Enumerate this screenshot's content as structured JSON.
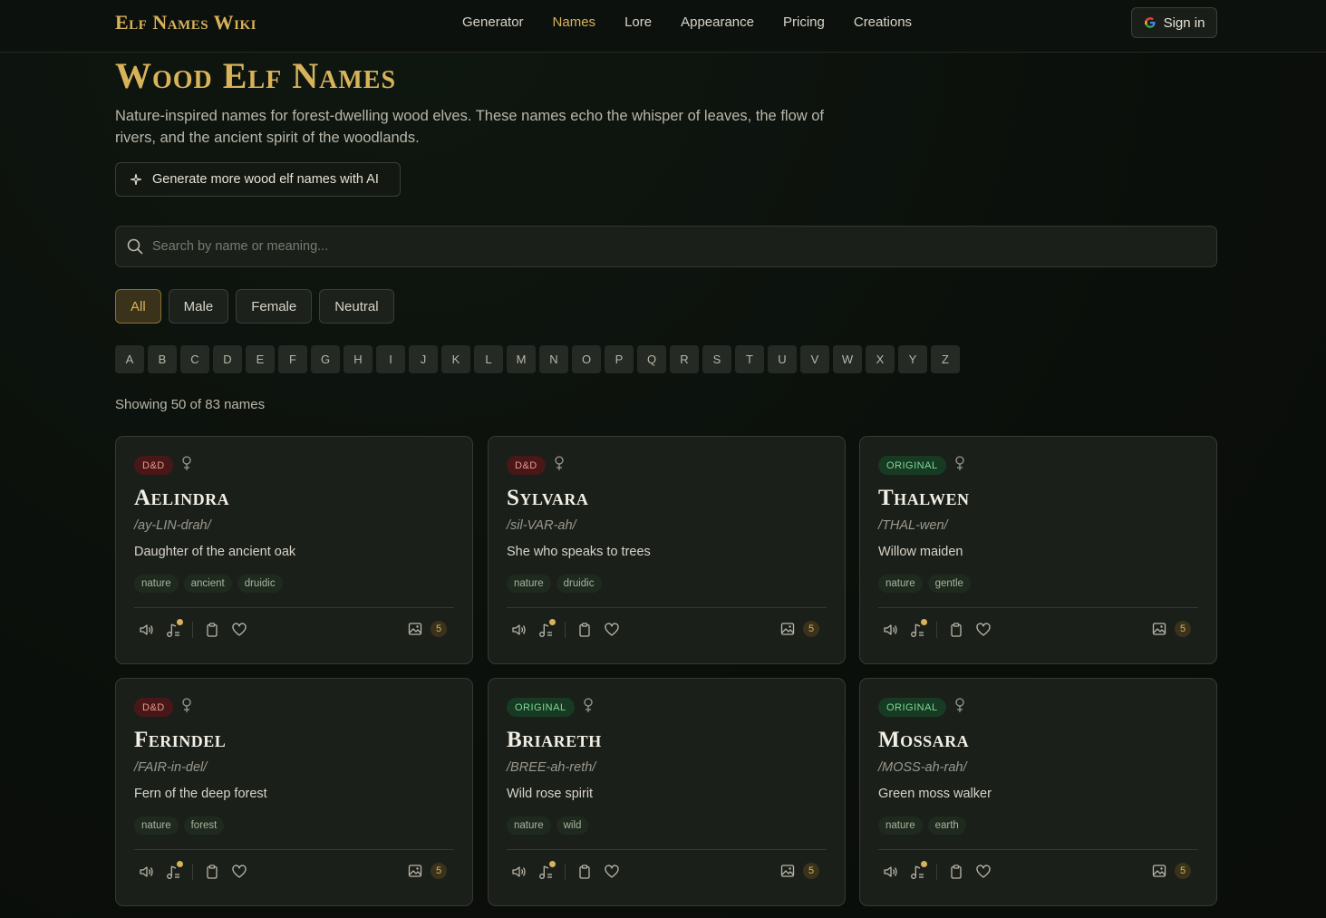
{
  "brand": "Elf Names Wiki",
  "nav": [
    "Generator",
    "Names",
    "Lore",
    "Appearance",
    "Pricing",
    "Creations"
  ],
  "nav_active": "Names",
  "signin_label": "Sign in",
  "page_title": "Wood Elf Names",
  "description": "Nature-inspired names for forest-dwelling wood elves. These names echo the whisper of leaves, the flow of rivers, and the ancient spirit of the woodlands.",
  "generate_button": "Generate more wood elf names with AI",
  "search": {
    "placeholder": "Search by name or meaning..."
  },
  "filters": [
    "All",
    "Male",
    "Female",
    "Neutral"
  ],
  "active_filter": "All",
  "letters": [
    "A",
    "B",
    "C",
    "D",
    "E",
    "F",
    "G",
    "H",
    "I",
    "J",
    "K",
    "L",
    "M",
    "N",
    "O",
    "P",
    "Q",
    "R",
    "S",
    "T",
    "U",
    "V",
    "W",
    "X",
    "Y",
    "Z"
  ],
  "count_text": "Showing 50 of 83 names",
  "colors": {
    "accent": "#d8b35a",
    "dnd_badge": "#4a1718",
    "original_badge": "#173a22"
  },
  "cards": [
    {
      "badge": "D&D",
      "badge_type": "dnd",
      "gender_icon": "female-icon",
      "name": "Aelindra",
      "pronunciation": "/ay-LIN-drah/",
      "meaning": "Daughter of the ancient oak",
      "tags": [
        "nature",
        "ancient",
        "druidic"
      ],
      "image_count": "5"
    },
    {
      "badge": "D&D",
      "badge_type": "dnd",
      "gender_icon": "female-icon",
      "name": "Sylvara",
      "pronunciation": "/sil-VAR-ah/",
      "meaning": "She who speaks to trees",
      "tags": [
        "nature",
        "druidic"
      ],
      "image_count": "5"
    },
    {
      "badge": "ORIGINAL",
      "badge_type": "orig",
      "gender_icon": "female-icon",
      "name": "Thalwen",
      "pronunciation": "/THAL-wen/",
      "meaning": "Willow maiden",
      "tags": [
        "nature",
        "gentle"
      ],
      "image_count": "5"
    },
    {
      "badge": "D&D",
      "badge_type": "dnd",
      "gender_icon": "female-icon",
      "name": "Ferindel",
      "pronunciation": "/FAIR-in-del/",
      "meaning": "Fern of the deep forest",
      "tags": [
        "nature",
        "forest"
      ],
      "image_count": "5"
    },
    {
      "badge": "ORIGINAL",
      "badge_type": "orig",
      "gender_icon": "female-icon",
      "name": "Briareth",
      "pronunciation": "/BREE-ah-reth/",
      "meaning": "Wild rose spirit",
      "tags": [
        "nature",
        "wild"
      ],
      "image_count": "5"
    },
    {
      "badge": "ORIGINAL",
      "badge_type": "orig",
      "gender_icon": "female-icon",
      "name": "Mossara",
      "pronunciation": "/MOSS-ah-rah/",
      "meaning": "Green moss walker",
      "tags": [
        "nature",
        "earth"
      ],
      "image_count": "5"
    }
  ]
}
